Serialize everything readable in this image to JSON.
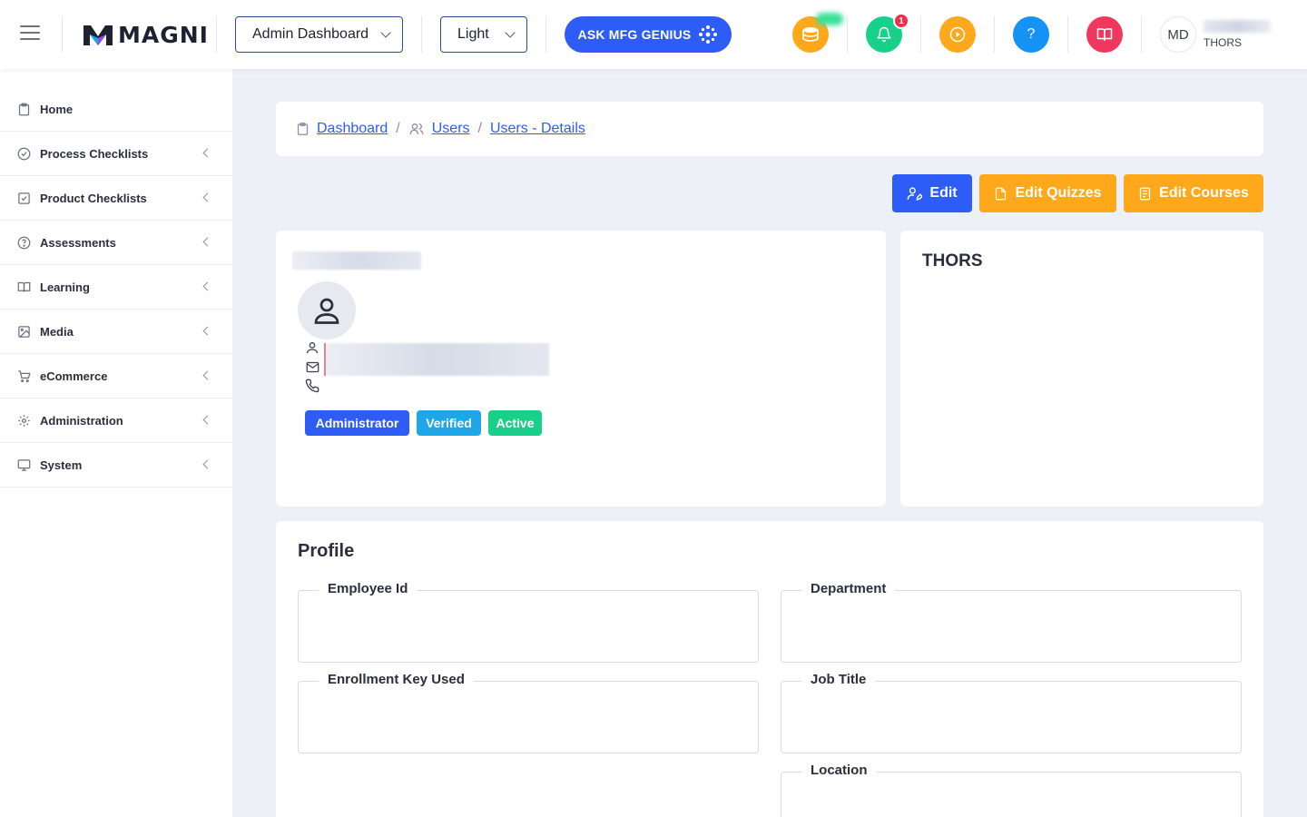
{
  "header": {
    "logo_text": "MAGNI",
    "dashboard_select": "Admin Dashboard",
    "theme_select": "Light",
    "genius_label": "ASK MFG GENIUS",
    "notification_count": "1",
    "user_initials": "MD",
    "user_org": "THORS"
  },
  "sidebar": {
    "items": [
      {
        "label": "Home",
        "icon": "clipboard-icon"
      },
      {
        "label": "Process Checklists",
        "icon": "check-circle-icon"
      },
      {
        "label": "Product Checklists",
        "icon": "check-square-icon"
      },
      {
        "label": "Assessments",
        "icon": "help-circle-icon"
      },
      {
        "label": "Learning",
        "icon": "book-open-icon"
      },
      {
        "label": "Media",
        "icon": "image-icon"
      },
      {
        "label": "eCommerce",
        "icon": "cart-icon"
      },
      {
        "label": "Administration",
        "icon": "gear-icon"
      },
      {
        "label": "System",
        "icon": "monitor-icon"
      }
    ]
  },
  "breadcrumb": {
    "items": [
      "Dashboard",
      "Users",
      "Users - Details"
    ]
  },
  "actions": {
    "edit": "Edit",
    "edit_quizzes": "Edit Quizzes",
    "edit_courses": "Edit Courses"
  },
  "user_card": {
    "tags": [
      "Administrator",
      "Verified",
      "Active"
    ]
  },
  "org_card": {
    "title": "THORS"
  },
  "profile": {
    "title": "Profile",
    "fields": {
      "employee_id": "Employee Id",
      "department": "Department",
      "enrollment_key": "Enrollment Key Used",
      "job_title": "Job Title",
      "location": "Location"
    }
  },
  "colors": {
    "primary": "#2e5cf6",
    "warning": "#ffa81c",
    "info": "#1ea7e8",
    "success": "#19d08a",
    "danger": "#f0385e"
  }
}
